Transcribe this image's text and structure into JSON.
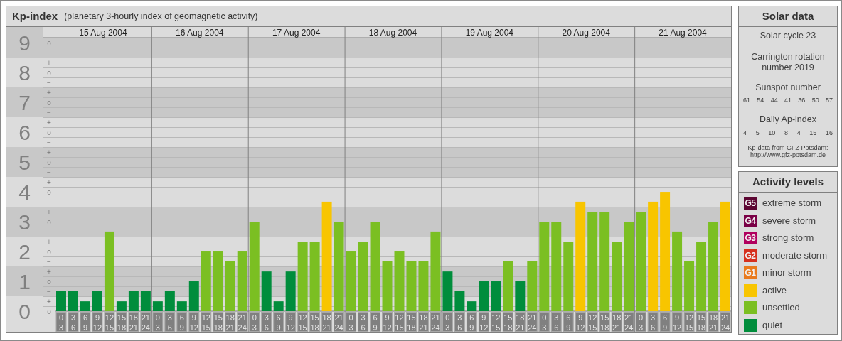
{
  "kp_panel": {
    "title": "Kp-index",
    "subtitle": "(planetary 3-hourly index of geomagnetic activity)",
    "dates": [
      "15 Aug 2004",
      "16 Aug 2004",
      "17 Aug 2004",
      "18 Aug 2004",
      "19 Aug 2004",
      "20 Aug 2004",
      "21 Aug 2004"
    ],
    "sub_marks": [
      "o",
      "−",
      "+",
      "o",
      "−",
      "+",
      "o",
      "−",
      "+",
      "o",
      "−",
      "+",
      "o",
      "−",
      "+",
      "o",
      "−",
      "+",
      "o",
      "−",
      "+",
      "o",
      "−",
      "+",
      "o",
      "−",
      "+",
      "o"
    ],
    "chart_data": {
      "type": "bar",
      "categories": [
        "0 3",
        "3 6",
        "6 9",
        "9 12",
        "12 15",
        "15 18",
        "18 21",
        "21 24",
        "0 3",
        "3 6",
        "6 9",
        "9 12",
        "12 15",
        "15 18",
        "18 21",
        "21 24",
        "0 3",
        "3 6",
        "6 9",
        "9 12",
        "12 15",
        "15 18",
        "18 21",
        "21 24",
        "0 3",
        "3 6",
        "6 9",
        "9 12",
        "12 15",
        "15 18",
        "18 21",
        "21 24",
        "0 3",
        "3 6",
        "6 9",
        "9 12",
        "12 15",
        "15 18",
        "18 21",
        "21 24",
        "0 3",
        "3 6",
        "6 9",
        "9 12",
        "12 15",
        "15 18",
        "18 21",
        "21 24",
        "0 3",
        "3 6",
        "6 9",
        "9 12",
        "12 15",
        "15 18",
        "18 21",
        "21 24"
      ],
      "values": [
        0.67,
        0.67,
        0.33,
        0.67,
        2.67,
        0.33,
        0.67,
        0.67,
        0.33,
        0.67,
        0.33,
        1,
        2,
        2,
        1.67,
        2,
        3,
        1.33,
        0.33,
        1.33,
        2.33,
        2.33,
        3.67,
        3,
        2,
        2.33,
        3,
        1.67,
        2,
        1.67,
        1.67,
        2.67,
        1.33,
        0.67,
        0.33,
        1,
        1,
        1.67,
        1,
        1.67,
        3,
        3,
        2.33,
        3.67,
        3.33,
        3.33,
        2.33,
        3,
        3.33,
        3.67,
        4,
        2.67,
        1.67,
        2.33,
        3,
        3.67
      ],
      "ylim": [
        0,
        9.17
      ],
      "yticks": [
        0,
        1,
        2,
        3,
        4,
        5,
        6,
        7,
        8,
        9
      ],
      "grid": true
    }
  },
  "solar_data": {
    "title": "Solar data",
    "solar_cycle": "Solar cycle 23",
    "carrington_rotation": "Carrington rotation number 2019",
    "sunspot_heading": "Sunspot number",
    "sunspot_numbers": [
      "61",
      "54",
      "44",
      "41",
      "36",
      "50",
      "57"
    ],
    "ap_heading": "Daily Ap-index",
    "ap_values": [
      "4",
      "5",
      "10",
      "8",
      "4",
      "15",
      "16"
    ],
    "source": "Kp-data from GFZ Potsdam:",
    "source_url": "http://www.gfz-potsdam.de"
  },
  "activity_levels": {
    "title": "Activity levels",
    "items": [
      {
        "badge": "G5",
        "label": "extreme storm",
        "color": "#5c0632"
      },
      {
        "badge": "G4",
        "label": "severe storm",
        "color": "#7a0046"
      },
      {
        "badge": "G3",
        "label": "strong storm",
        "color": "#b0005e"
      },
      {
        "badge": "G2",
        "label": "moderate storm",
        "color": "#d6301e"
      },
      {
        "badge": "G1",
        "label": "minor storm",
        "color": "#e97a1d"
      },
      {
        "label": "active",
        "color": "#f8c500"
      },
      {
        "label": "unsettled",
        "color": "#7bbf22"
      },
      {
        "label": "quiet",
        "color": "#008d3c"
      }
    ]
  }
}
